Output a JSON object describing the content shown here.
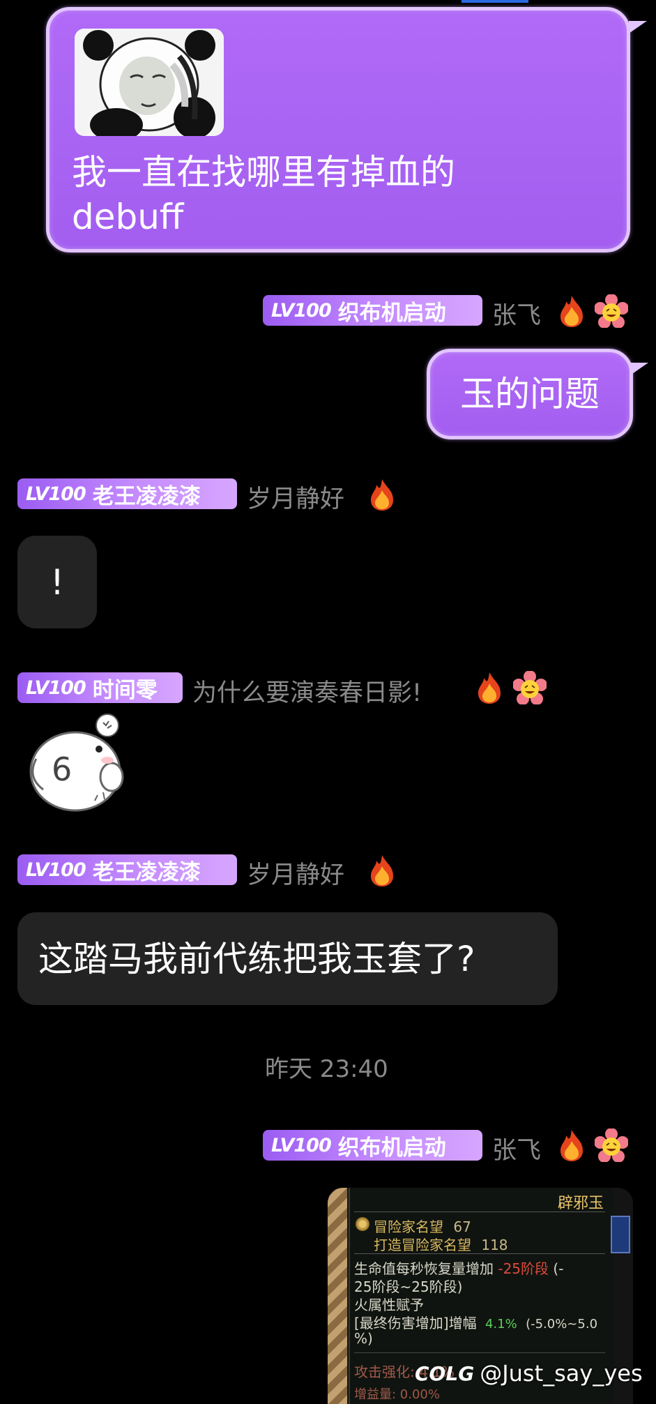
{
  "messages": {
    "m1": {
      "line1": "我一直在找哪里有掉血的",
      "line2": "debuff"
    },
    "m2": {
      "badge_lv": "LV100",
      "badge_title": "织布机启动",
      "nickname": "张飞",
      "text": "玉的问题"
    },
    "m3": {
      "badge_lv": "LV100",
      "badge_title": "老王凌凌漆",
      "nickname": "岁月静好",
      "text": "!"
    },
    "m4": {
      "badge_lv": "LV100",
      "badge_title": "时间零",
      "nickname": "为什么要演奏春日影!",
      "sticker_text": "6"
    },
    "m5": {
      "badge_lv": "LV100",
      "badge_title": "老王凌凌漆",
      "nickname": "岁月静好",
      "text": "这踏马我前代练把我玉套了?"
    },
    "timestamp": "昨天 23:40",
    "m6": {
      "badge_lv": "LV100",
      "badge_title": "织布机启动",
      "nickname": "张飞"
    }
  },
  "game_tooltip": {
    "item_name": "辟邪玉",
    "fame_label": "冒险家名望",
    "fame_value": "67",
    "craft_fame_label": "打造冒险家名望",
    "craft_fame_value": "118",
    "hp_regen_line_a": "生命值每秒恢复量增加",
    "hp_regen_value": "-25阶段",
    "hp_regen_line_a_tail": "(-",
    "hp_regen_line_b": "25阶段~25阶段)",
    "fire_grant": "火属性赋予",
    "final_dmg_label": "[最终伤害增加]增幅",
    "final_dmg_value": "4.1%",
    "final_dmg_range": "(-5.0%~5.0",
    "final_dmg_range_tail": "%)",
    "attack_boost": "攻击强化: 4.1%",
    "gain": "增益量: 0.00%"
  },
  "watermark": {
    "logo": "COLG",
    "handle": "@Just_say_yes"
  },
  "colors": {
    "bubble_purple": "#a35ef0",
    "bubble_border": "#e2c4ff",
    "dark_bubble": "#232323",
    "nickname_gray": "#8a8a8a",
    "background": "#000000"
  },
  "icons": [
    "fire-icon",
    "smiley-flower-icon",
    "panda-meme-sticker",
    "bird-sticker"
  ]
}
